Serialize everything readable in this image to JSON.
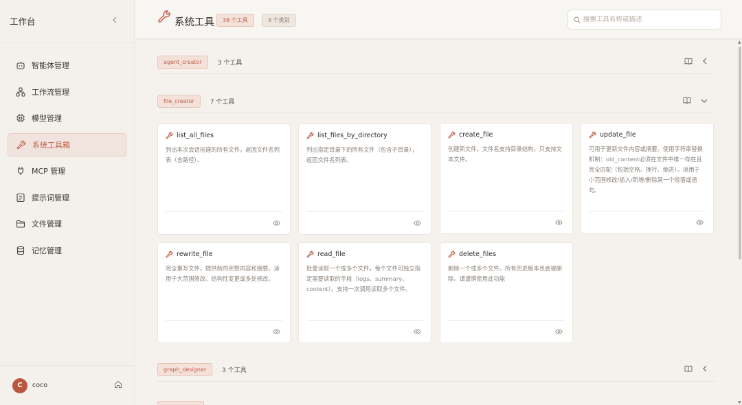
{
  "sidebar": {
    "title": "工作台",
    "items": [
      {
        "label": "智能体管理",
        "icon": "robot-icon"
      },
      {
        "label": "工作流管理",
        "icon": "workflow-icon"
      },
      {
        "label": "模型管理",
        "icon": "chip-icon"
      },
      {
        "label": "系统工具箱",
        "icon": "wrench-icon",
        "active": true
      },
      {
        "label": "MCP 管理",
        "icon": "plug-icon"
      },
      {
        "label": "提示词管理",
        "icon": "document-icon"
      },
      {
        "label": "文件管理",
        "icon": "folder-icon"
      },
      {
        "label": "记忆管理",
        "icon": "database-icon"
      }
    ],
    "user": {
      "initial": "C",
      "name": "coco"
    }
  },
  "header": {
    "title": "系统工具",
    "tools_badge": "38 个工具",
    "categories_badge": "9 个类别",
    "search_placeholder": "搜索工具名称或描述"
  },
  "groups": [
    {
      "tag": "agent_creator",
      "count": "3 个工具",
      "expanded": false
    },
    {
      "tag": "file_creator",
      "count": "7 个工具",
      "expanded": true,
      "tools": [
        {
          "name": "list_all_files",
          "desc": "列出本次会话创建的所有文件，返回文件名列表（含路径）。"
        },
        {
          "name": "list_files_by_directory",
          "desc": "列出指定目录下的所有文件（包含子目录），返回文件名列表。"
        },
        {
          "name": "create_file",
          "desc": "创建新文件。文件名支持目录结构。只支持文本文件。"
        },
        {
          "name": "update_file",
          "desc": "可用于更新文件内容或摘要。使用字符串替换机制：old_content必须在文件中唯一存在且完全匹配（包括空格、换行、缩进）。适用于小范围修改/插入/新增/删除某一个段落或语句。"
        },
        {
          "name": "rewrite_file",
          "desc": "完全重写文件，提供新的完整内容和摘要。适用于大范围修改、结构性变更或多处修改。"
        },
        {
          "name": "read_file",
          "desc": "批量读取一个或多个文件，每个文件可独立指定需要读取的字段（logs、summary、content）。支持一次调用读取多个文件。"
        },
        {
          "name": "delete_files",
          "desc": "删除一个或多个文件。所有历史版本也会被删除。请谨慎使用此功能"
        }
      ]
    },
    {
      "tag": "graph_designer",
      "count": "3 个工具",
      "expanded": false
    }
  ],
  "colors": {
    "accent": "#c0604a",
    "accent_bg": "#f4e2da",
    "background": "#f5f2ee"
  }
}
